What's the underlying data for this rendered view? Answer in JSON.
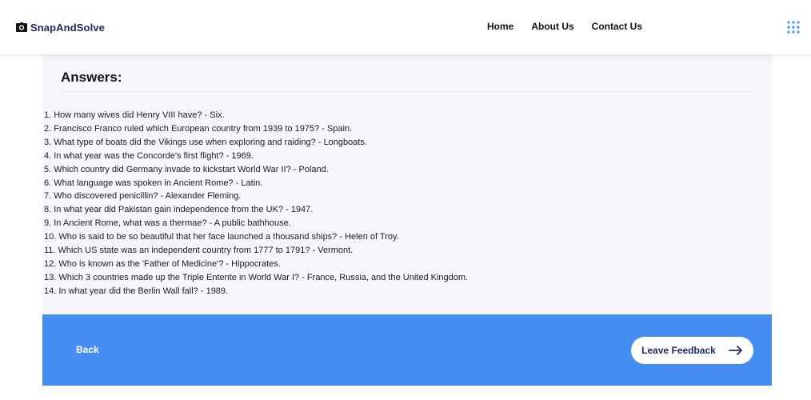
{
  "header": {
    "brand": "SnapAndSolve",
    "nav": [
      {
        "label": "Home"
      },
      {
        "label": "About Us"
      },
      {
        "label": "Contact Us"
      }
    ]
  },
  "main": {
    "title": "Answers:",
    "answers": [
      "1. How many wives did Henry VIII have? - Six.",
      "2. Francisco Franco ruled which European country from 1939 to 1975? - Spain.",
      "3. What type of boats did the Vikings use when exploring and raiding? - Longboats.",
      "4. In what year was the Concorde's first flight? - 1969.",
      "5. Which country did Germany invade to kickstart World War II? - Poland.",
      "6. What language was spoken in Ancient Rome? - Latin.",
      "7. Who discovered penicillin? - Alexander Fleming.",
      "8. In what year did Pakistan gain independence from the UK? - 1947.",
      "9. In Ancient Rome, what was a thermae? - A public bathhouse.",
      "10. Who is said to be so beautiful that her face launched a thousand ships? - Helen of Troy.",
      "11. Which US state was an independent country from 1777 to 1791? - Vermont.",
      "12. Who is known as the 'Father of Medicine'? - Hippocrates.",
      "13. Which 3 countries made up the Triple Entente in World War I? - France, Russia, and the United Kingdom.",
      "14. In what year did the Berlin Wall fall? - 1989."
    ]
  },
  "footer": {
    "back_label": "Back",
    "feedback_label": "Leave Feedback"
  },
  "icons": {
    "brand": "camera-icon",
    "menu": "grid-menu-icon",
    "feedback": "arrow-right-icon"
  },
  "colors": {
    "brand_text": "#1f2a6b",
    "footer_bg": "#468df2",
    "content_bg": "#f7f5fa",
    "menu_dots": "#4a8ff0"
  }
}
